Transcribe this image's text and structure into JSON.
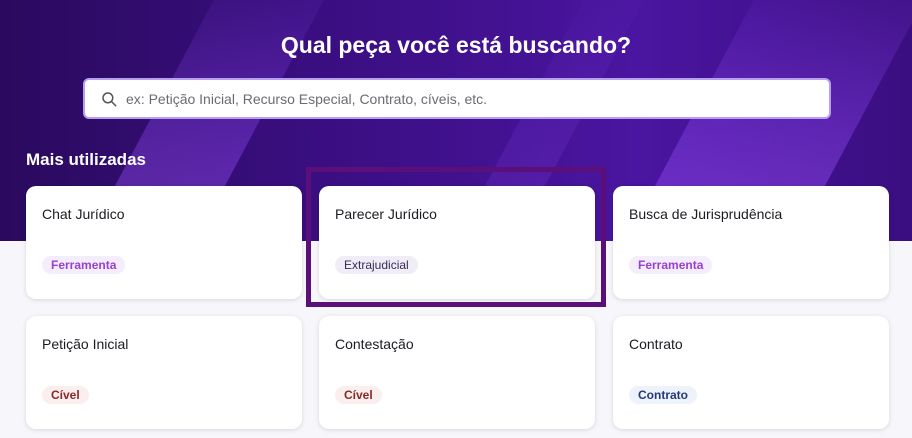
{
  "header": {
    "title": "Qual peça você está buscando?"
  },
  "search": {
    "placeholder": "ex: Petição Inicial, Recurso Especial, Contrato, cíveis, etc.",
    "icon": "search-icon"
  },
  "section": {
    "title": "Mais utilizadas"
  },
  "cards": [
    {
      "title": "Chat Jurídico",
      "tag": "Ferramenta"
    },
    {
      "title": "Parecer Jurídico",
      "tag": "Extrajudicial"
    },
    {
      "title": "Busca de Jurisprudência",
      "tag": "Ferramenta"
    },
    {
      "title": "Petição Inicial",
      "tag": "Cível"
    },
    {
      "title": "Contestação",
      "tag": "Cível"
    },
    {
      "title": "Contrato",
      "tag": "Contrato"
    }
  ],
  "colors": {
    "hero_dark": "#2a0a5e",
    "hero_light": "#4a15a0",
    "search_border": "#b79ef2",
    "highlight_border": "#5a0f7a",
    "tag_ferramenta": "#9a3fd0",
    "tag_civel": "#8a2828",
    "tag_contrato": "#243a78"
  }
}
